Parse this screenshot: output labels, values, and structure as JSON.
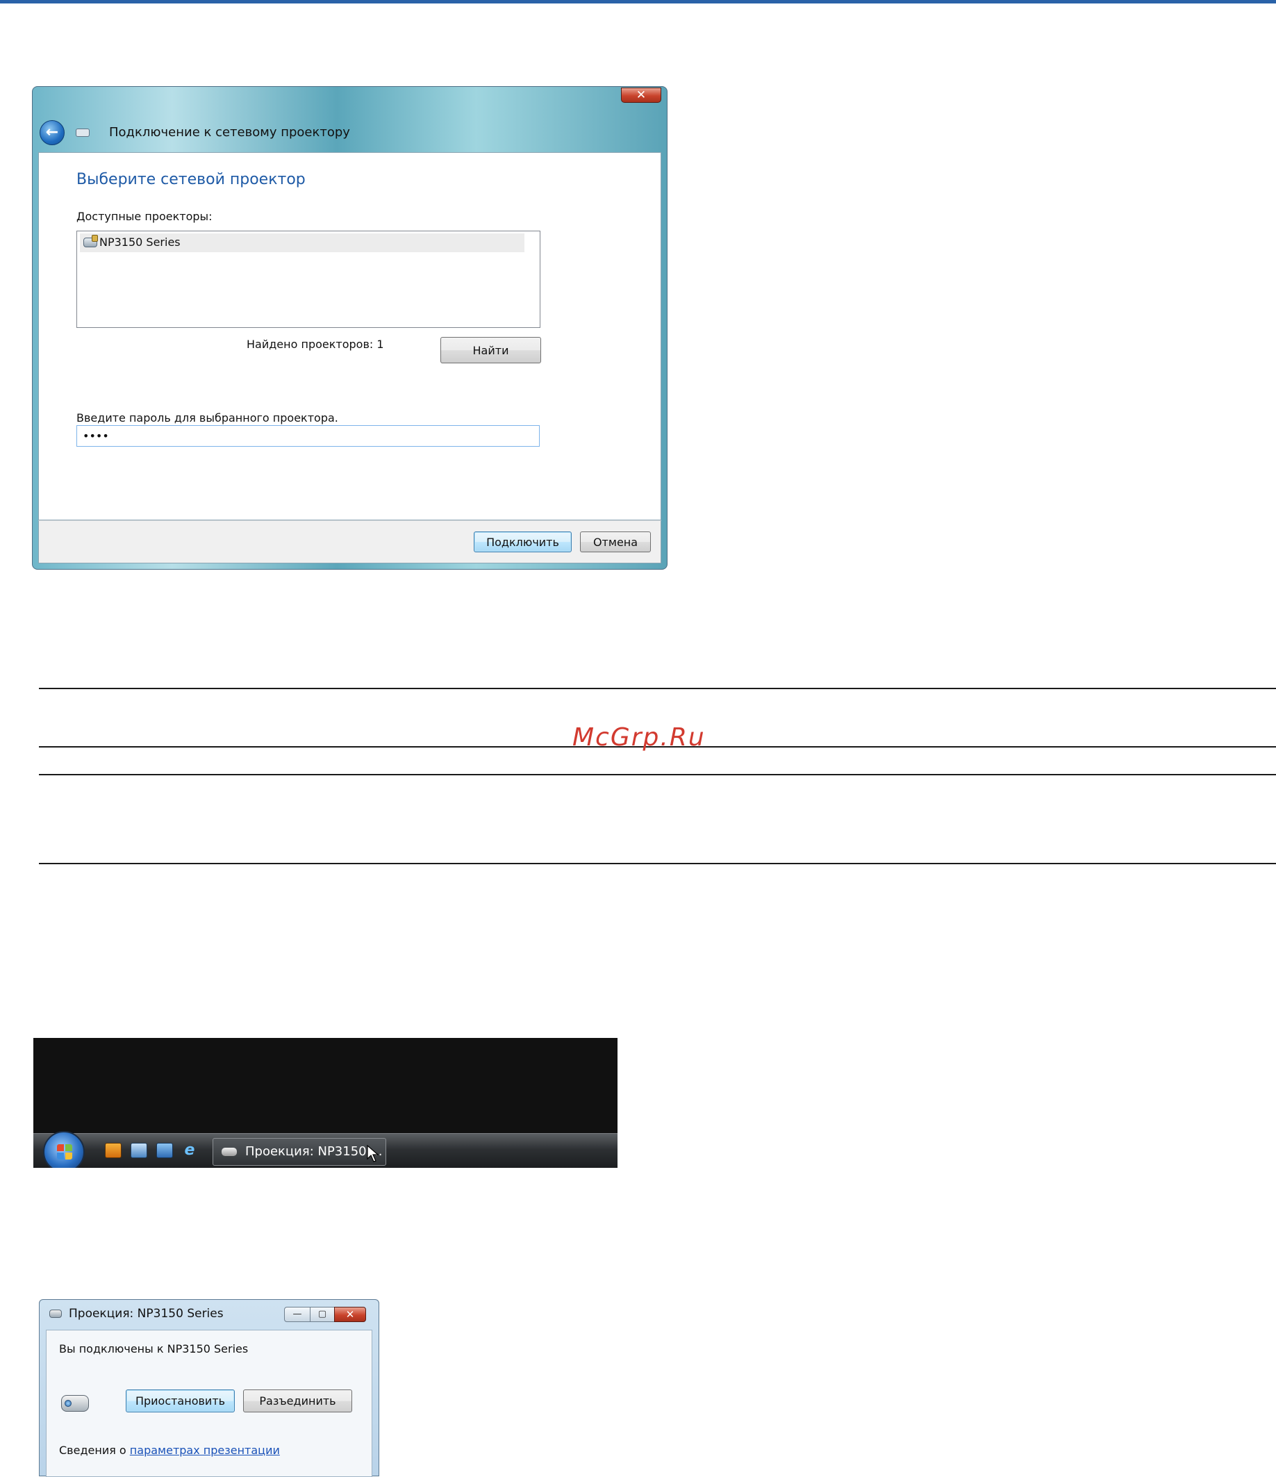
{
  "dialog_connect": {
    "title": "Подключение к сетевому проектору",
    "close_label": "✕",
    "back_label": "←",
    "heading": "Выберите сетевой проектор",
    "available_label": "Доступные проекторы:",
    "projectors": [
      {
        "name": "NP3150 Series"
      }
    ],
    "found_text": "Найдено проекторов: 1",
    "find_button": "Найти",
    "password_label": "Введите пароль для выбранного проектора.",
    "password_value": "••••",
    "connect_button": "Подключить",
    "cancel_button": "Отмена"
  },
  "watermark": "McGrp.Ru",
  "taskbar": {
    "task_label": "Проекция: NP3150 ...",
    "ie_glyph": "e"
  },
  "dialog_projection": {
    "title": "Проекция: NP3150 Series",
    "min_label": "—",
    "max_label": "▢",
    "close_label": "✕",
    "status_text": "Вы подключены к NP3150 Series",
    "pause_button": "Приостановить",
    "disconnect_button": "Разъединить",
    "info_prefix": "Сведения о ",
    "info_link": "параметрах презентации"
  },
  "colors": {
    "accent_heading": "#1e5aa6",
    "link": "#1a52b8",
    "watermark": "#d23a2f",
    "top_line": "#2a62a8"
  }
}
